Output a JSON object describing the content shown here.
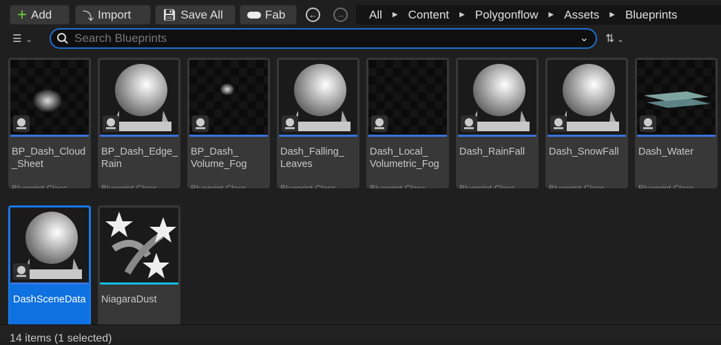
{
  "toolbar": {
    "add": "Add",
    "import": "Import",
    "save_all": "Save All",
    "fab": "Fab"
  },
  "breadcrumb": [
    "All",
    "Content",
    "Polygonflow",
    "Assets",
    "Blueprints"
  ],
  "search": {
    "placeholder": "Search Blueprints",
    "value": ""
  },
  "assets": [
    {
      "name": "BP_Dash_Cloud\n_Sheet",
      "type": "Blueprint Class",
      "thumb": "cloud",
      "selected": false
    },
    {
      "name": "BP_Dash_Edge_\nRain",
      "type": "Blueprint Class",
      "thumb": "sphere",
      "selected": false
    },
    {
      "name": "BP_Dash_\nVolume_Fog",
      "type": "Blueprint Class",
      "thumb": "fog",
      "selected": false
    },
    {
      "name": "Dash_Falling_\nLeaves",
      "type": "Blueprint Class",
      "thumb": "sphere",
      "selected": false
    },
    {
      "name": "Dash_Local_\nVolumetric_Fog",
      "type": "Blueprint Class",
      "thumb": "empty",
      "selected": false
    },
    {
      "name": "Dash_RainFall",
      "type": "Blueprint Class",
      "thumb": "sphere",
      "selected": false
    },
    {
      "name": "Dash_SnowFall",
      "type": "Blueprint Class",
      "thumb": "sphere",
      "selected": false
    },
    {
      "name": "Dash_Water",
      "type": "Blueprint Class",
      "thumb": "water",
      "selected": false
    },
    {
      "name": "DashSceneData",
      "type": "",
      "thumb": "sphere",
      "selected": true
    },
    {
      "name": "NiagaraDust",
      "type": "",
      "thumb": "stars",
      "selected": false
    }
  ],
  "status": "14 items (1 selected)"
}
